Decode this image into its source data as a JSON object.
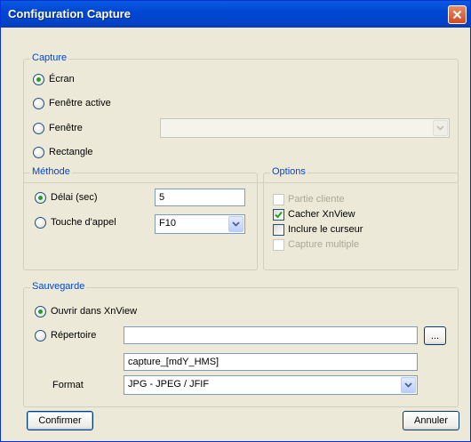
{
  "window": {
    "title": "Configuration Capture"
  },
  "capture": {
    "legend": "Capture",
    "options": [
      {
        "label": "Écran",
        "selected": true
      },
      {
        "label": "Fenêtre active",
        "selected": false
      },
      {
        "label": "Fenêtre",
        "selected": false
      },
      {
        "label": "Rectangle",
        "selected": false
      }
    ],
    "window_select_value": ""
  },
  "method": {
    "legend": "Méthode",
    "delay_label": "Délai (sec)",
    "delay_value": "5",
    "hotkey_label": "Touche d'appel",
    "hotkey_value": "F10"
  },
  "options": {
    "legend": "Options",
    "items": [
      {
        "label": "Partie cliente",
        "checked": false,
        "enabled": false
      },
      {
        "label": "Cacher XnView",
        "checked": true,
        "enabled": true
      },
      {
        "label": "Inclure le curseur",
        "checked": false,
        "enabled": true
      },
      {
        "label": "Capture multiple",
        "checked": false,
        "enabled": false
      }
    ]
  },
  "save": {
    "legend": "Sauvegarde",
    "open_label": "Ouvrir dans XnView",
    "dir_label": "Répertoire",
    "dir_value": "",
    "browse_label": "...",
    "filename_value": "capture_[mdY_HMS]",
    "format_label": "Format",
    "format_value": "JPG - JPEG / JFIF"
  },
  "buttons": {
    "confirm": "Confirmer",
    "cancel": "Annuler"
  },
  "colors": {
    "titlebar": "#0046d5",
    "legend_text": "#0046d5",
    "radio_dot": "#21a121",
    "close": "#d24a22"
  }
}
